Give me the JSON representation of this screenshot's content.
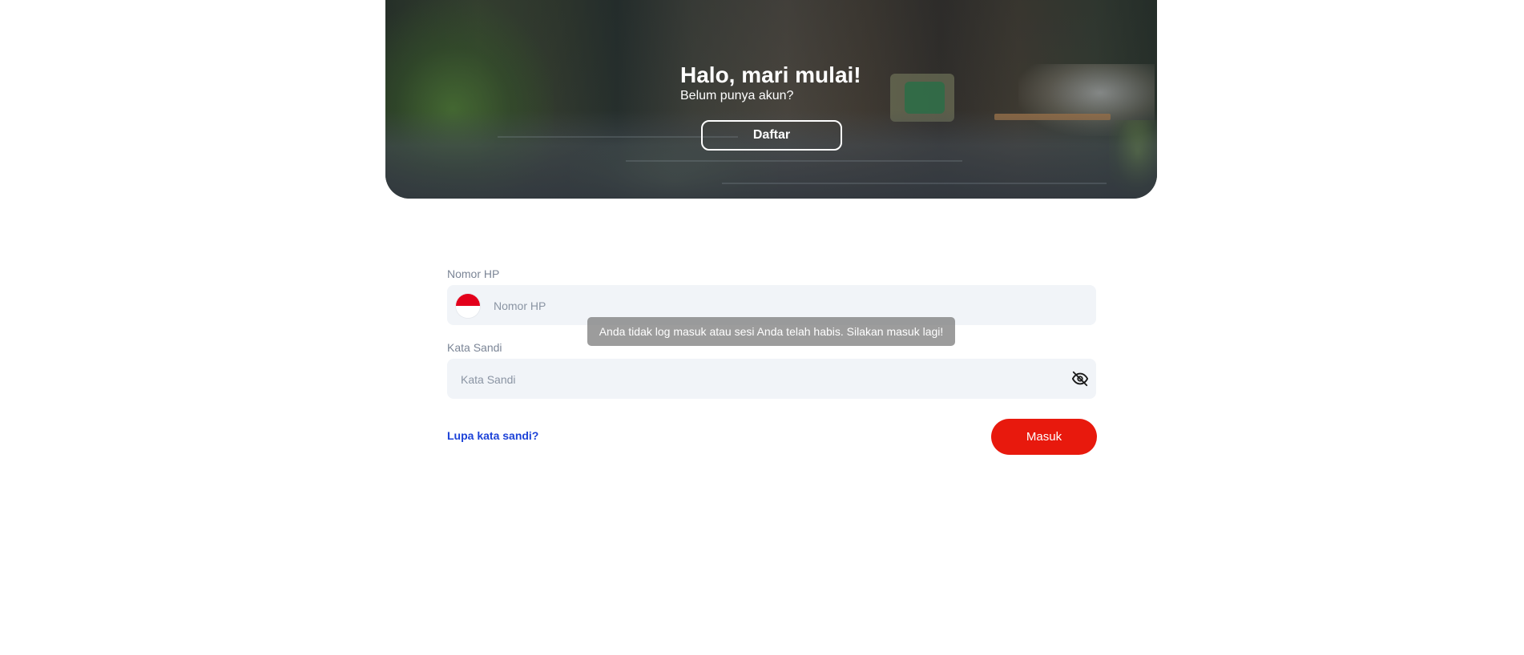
{
  "hero": {
    "title": "Halo, mari mulai!",
    "subtitle": "Belum punya akun?",
    "register_label": "Daftar"
  },
  "form": {
    "phone": {
      "label": "Nomor HP",
      "placeholder": "Nomor HP",
      "value": "",
      "country_icon": "indonesia-flag-icon"
    },
    "password": {
      "label": "Kata Sandi",
      "placeholder": "Kata Sandi",
      "value": "",
      "toggle_icon": "eye-off-icon"
    },
    "forgot_label": "Lupa kata sandi?",
    "login_label": "Masuk"
  },
  "toast": {
    "message": "Anda tidak log masuk atau sesi Anda telah habis. Silakan masuk lagi!"
  },
  "colors": {
    "primary": "#e8190d",
    "link": "#1d43d8",
    "field_bg": "#f1f4f8",
    "label": "#7b8596"
  }
}
